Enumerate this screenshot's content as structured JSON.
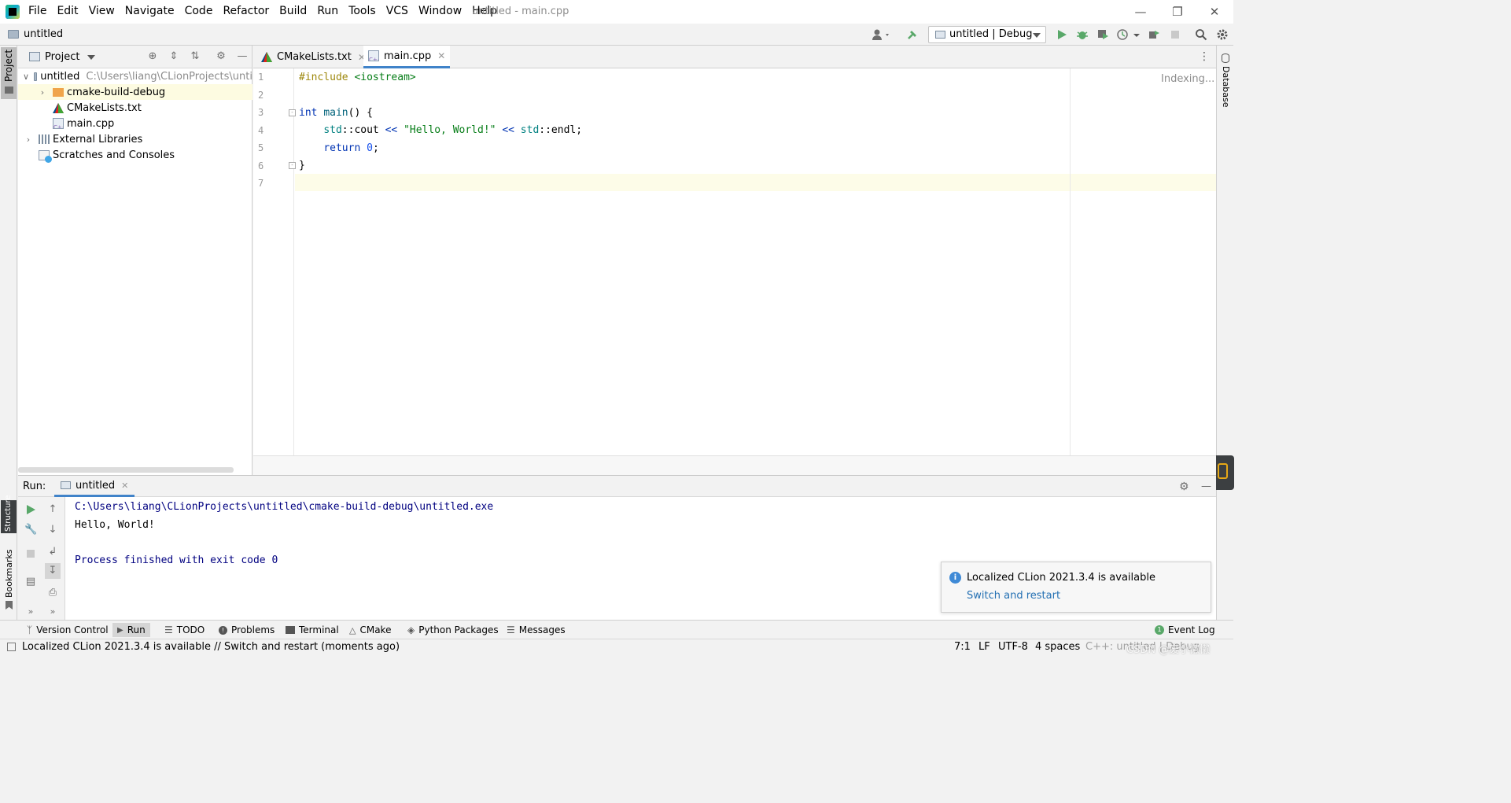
{
  "window": {
    "title": "untitled - main.cpp",
    "menu": [
      "File",
      "Edit",
      "View",
      "Navigate",
      "Code",
      "Refactor",
      "Build",
      "Run",
      "Tools",
      "VCS",
      "Window",
      "Help"
    ]
  },
  "navbar": {
    "project": "untitled",
    "run_config": "untitled | Debug"
  },
  "project_panel": {
    "title": "Project",
    "tree": [
      {
        "label": "untitled",
        "path": "C:\\Users\\liang\\CLionProjects\\unti"
      },
      {
        "label": "cmake-build-debug"
      },
      {
        "label": "CMakeLists.txt"
      },
      {
        "label": "main.cpp"
      },
      {
        "label": "External Libraries"
      },
      {
        "label": "Scratches and Consoles"
      }
    ]
  },
  "editor": {
    "tabs": [
      "CMakeLists.txt",
      "main.cpp"
    ],
    "active_tab": "main.cpp",
    "line_numbers": [
      "1",
      "2",
      "3",
      "4",
      "5",
      "6",
      "7"
    ],
    "indexing": "Indexing..."
  },
  "left_strip": {
    "project": "Project",
    "structure": "Structure",
    "bookmarks": "Bookmarks"
  },
  "right_strip": {
    "database": "Database"
  },
  "run_panel": {
    "label": "Run:",
    "tab": "untitled",
    "output": [
      "C:\\Users\\liang\\CLionProjects\\untitled\\cmake-build-debug\\untitled.exe",
      "Hello, World!",
      "",
      "Process finished with exit code 0"
    ]
  },
  "notification": {
    "title": "Localized CLion 2021.3.4 is available",
    "action": "Switch and restart"
  },
  "bottom_tabs": [
    "Version Control",
    "Run",
    "TODO",
    "Problems",
    "Terminal",
    "CMake",
    "Python Packages",
    "Messages"
  ],
  "event_log": "Event Log",
  "status": {
    "message": "Localized CLion 2021.3.4 is available // Switch and restart (moments ago)",
    "position": "7:1",
    "line_sep": "LF",
    "encoding": "UTF-8",
    "indent": "4 spaces",
    "context": "C++: untitled | Debug"
  },
  "watermark": "CSDN @废小懒懒",
  "colors": {
    "accent": "#4083c9",
    "run_green": "#59a869",
    "keyword": "#0033b3",
    "string": "#067d17"
  }
}
